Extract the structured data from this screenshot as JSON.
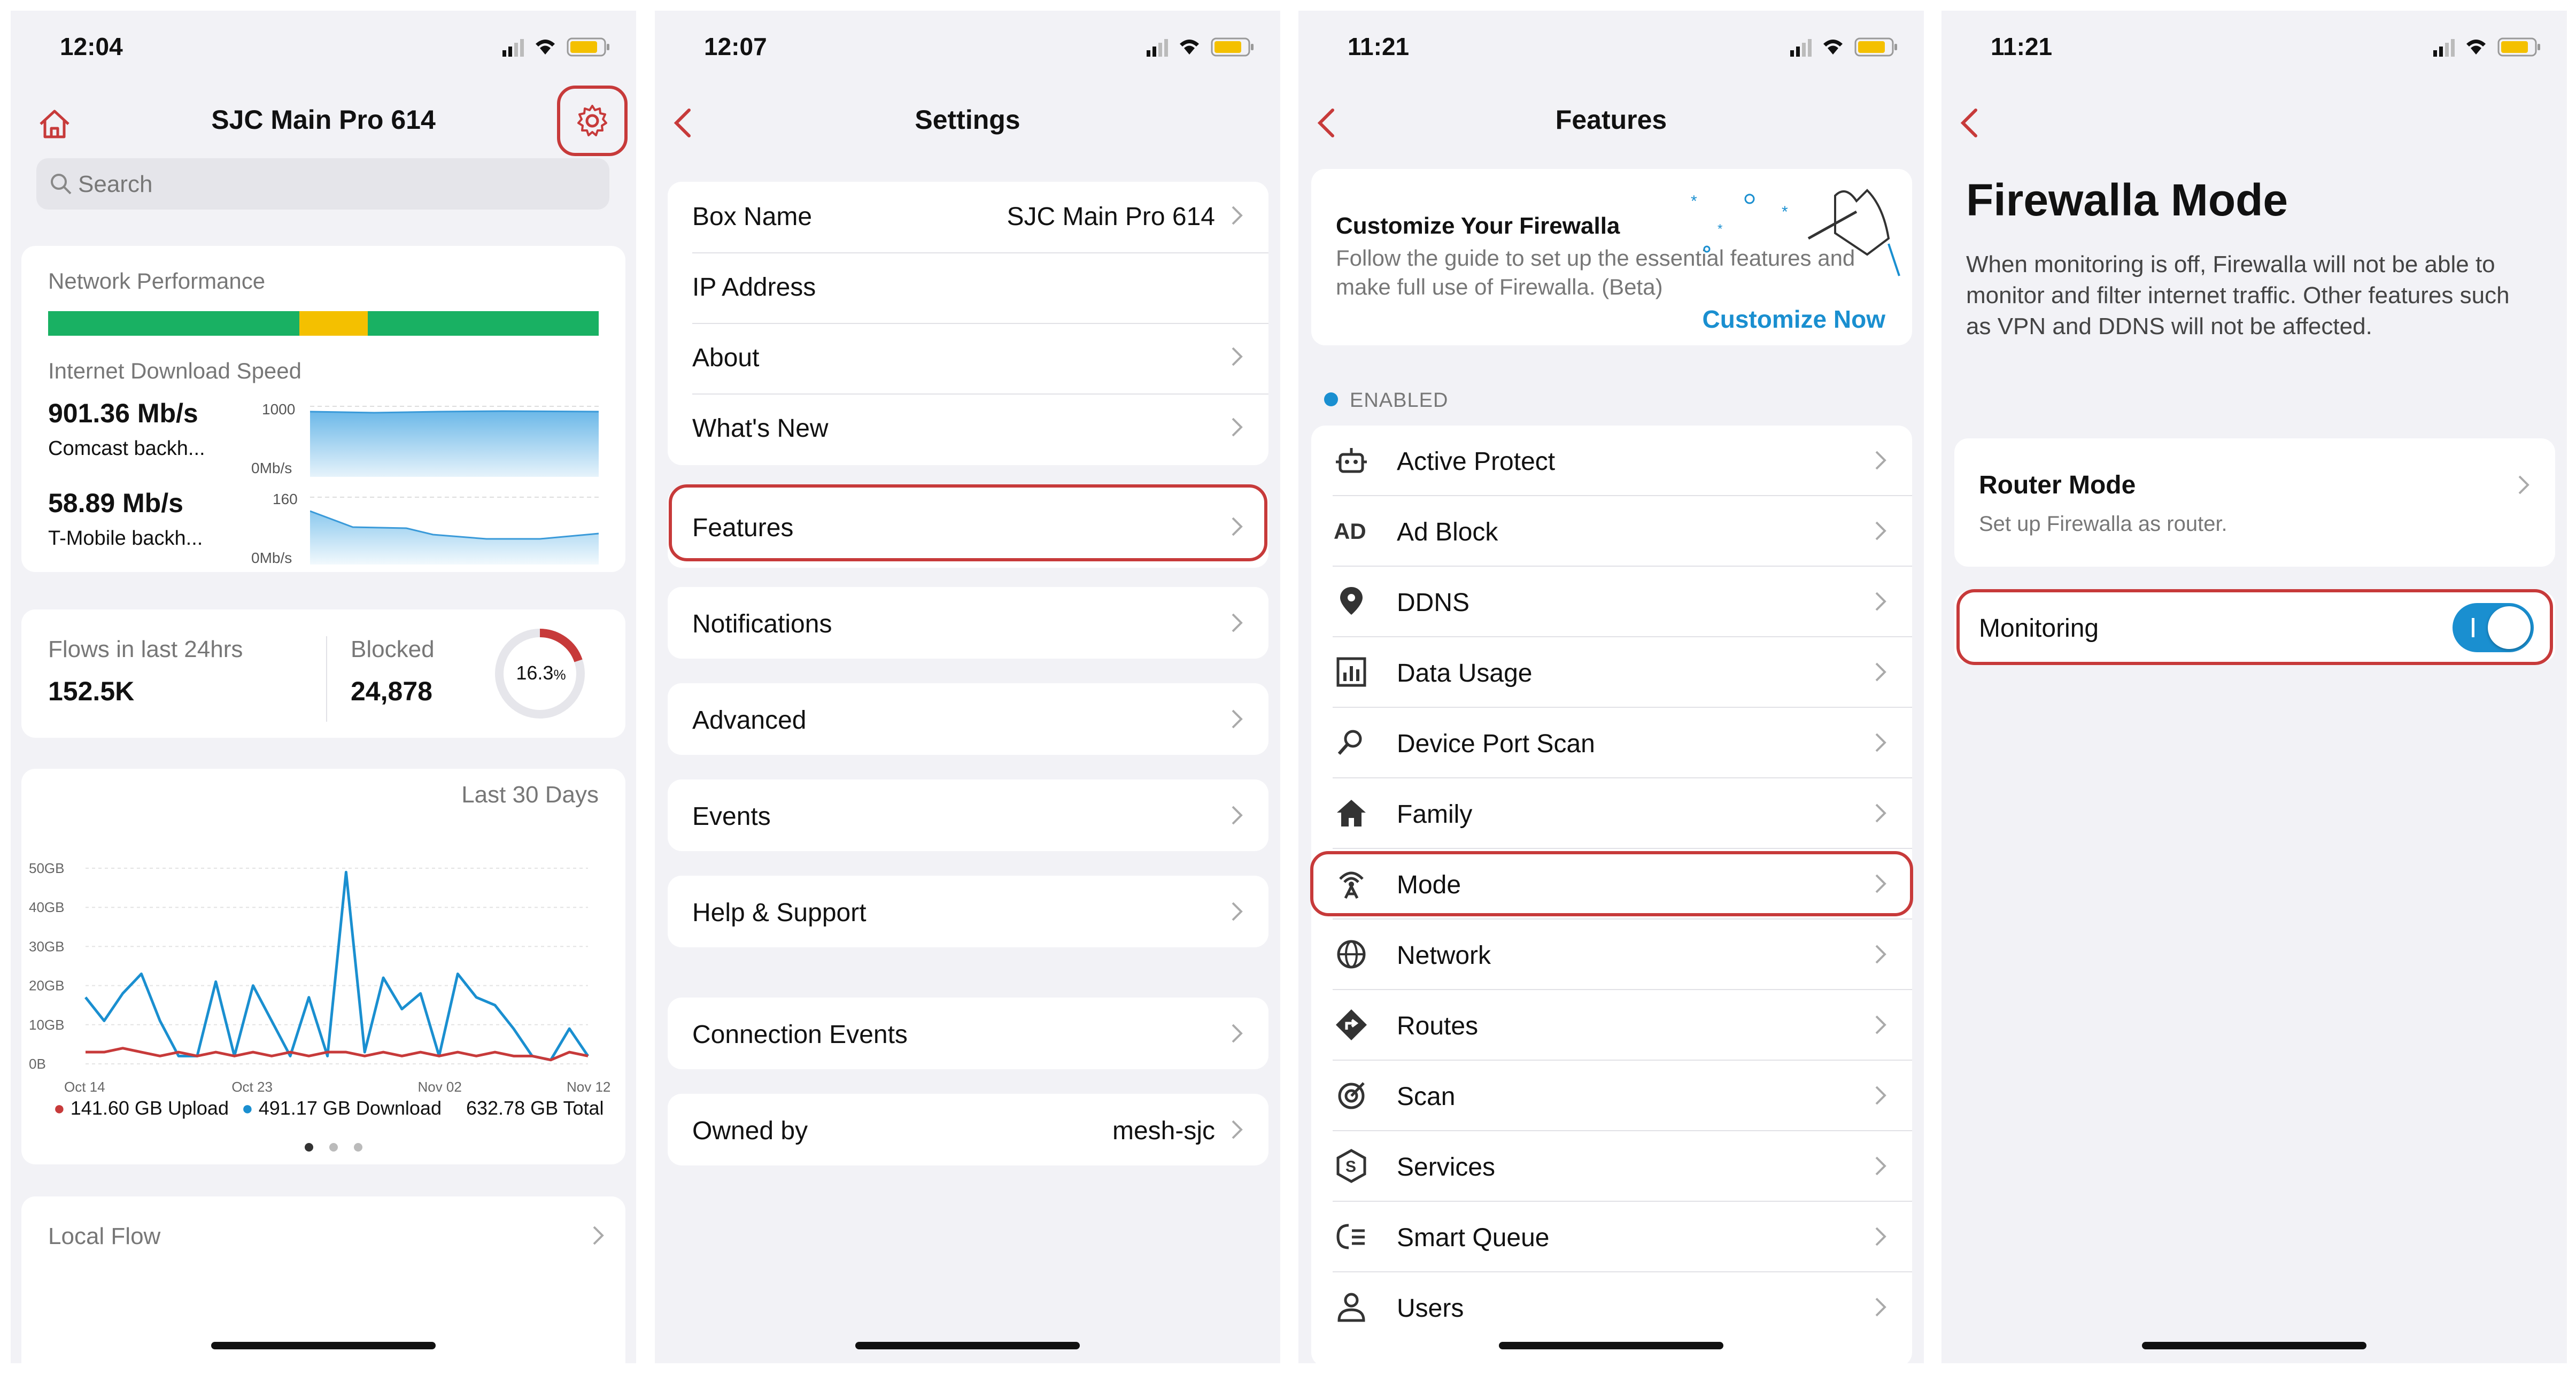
{
  "colors": {
    "accent": "#c73a3a",
    "link": "#1a8fd0",
    "green": "#19b163",
    "yellow": "#f4c000",
    "toggle": "#1a8fd0"
  },
  "screen1": {
    "time": "12:04",
    "title": "SJC Main Pro 614",
    "search_placeholder": "Search",
    "network_performance_label": "Network Performance",
    "internet_download_label": "Internet Download Speed",
    "wan1": {
      "speed": "901.36 Mb/s",
      "name": "Comcast backh...",
      "axis_top": "1000",
      "axis_bottom": "0Mb/s"
    },
    "wan2": {
      "speed": "58.89 Mb/s",
      "name": "T-Mobile backh...",
      "axis_top": "160",
      "axis_bottom": "0Mb/s"
    },
    "flows_label": "Flows in last 24hrs",
    "flows_value": "152.5K",
    "blocked_label": "Blocked",
    "blocked_value": "24,878",
    "blocked_percent": "16.3",
    "blocked_percent_unit": "%",
    "period_label": "Last 30 Days",
    "y_ticks": [
      "50GB",
      "40GB",
      "30GB",
      "20GB",
      "10GB",
      "0B"
    ],
    "x_ticks": [
      "Oct 14",
      "Oct 23",
      "Nov 02",
      "Nov 12"
    ],
    "legend_upload": "141.60 GB Upload",
    "legend_download": "491.17 GB Download",
    "legend_total": "632.78 GB Total",
    "local_flow_label": "Local Flow"
  },
  "chart_data": {
    "type": "line",
    "ylabel": "",
    "ylim": [
      0,
      50
    ],
    "x_ticks": [
      "Oct 14",
      "Oct 23",
      "Nov 02",
      "Nov 12"
    ],
    "series": [
      {
        "name": "Download",
        "values": [
          17,
          11,
          18,
          23,
          11,
          2,
          2,
          21,
          2,
          20,
          11,
          2,
          17,
          2,
          49,
          3,
          22,
          14,
          18,
          2,
          23,
          17,
          15,
          9,
          2,
          1,
          9,
          2
        ]
      },
      {
        "name": "Upload",
        "values": [
          3,
          3,
          4,
          3,
          2,
          3,
          2,
          3,
          2,
          3,
          2,
          3,
          2,
          3,
          3,
          2,
          3,
          2,
          3,
          2,
          3,
          2,
          3,
          2,
          2,
          1,
          3,
          2
        ]
      }
    ]
  },
  "screen2": {
    "time": "12:07",
    "title": "Settings",
    "box_name_label": "Box Name",
    "box_name_value": "SJC Main Pro 614",
    "ip_label": "IP Address",
    "about_label": "About",
    "whats_new_label": "What's New",
    "features_label": "Features",
    "notifications_label": "Notifications",
    "advanced_label": "Advanced",
    "events_label": "Events",
    "help_label": "Help & Support",
    "connection_events_label": "Connection Events",
    "owned_by_label": "Owned by",
    "owned_by_value": "mesh-sjc"
  },
  "screen3": {
    "time": "11:21",
    "title": "Features",
    "customize_title": "Customize Your Firewalla",
    "customize_desc": "Follow the guide to set up the essential features and make full use of Firewalla. (Beta)",
    "customize_link": "Customize Now",
    "enabled_label": "ENABLED",
    "features": [
      {
        "label": "Active Protect",
        "icon": "robot-icon"
      },
      {
        "label": "Ad Block",
        "icon": "ad-icon"
      },
      {
        "label": "DDNS",
        "icon": "location-pin-icon"
      },
      {
        "label": "Data Usage",
        "icon": "bar-chart-icon"
      },
      {
        "label": "Device Port Scan",
        "icon": "magnifier-icon"
      },
      {
        "label": "Family",
        "icon": "house-icon"
      },
      {
        "label": "Mode",
        "icon": "antenna-icon"
      },
      {
        "label": "Network",
        "icon": "globe-icon"
      },
      {
        "label": "Routes",
        "icon": "route-sign-icon"
      },
      {
        "label": "Scan",
        "icon": "target-icon"
      },
      {
        "label": "Services",
        "icon": "services-icon"
      },
      {
        "label": "Smart Queue",
        "icon": "queue-icon"
      },
      {
        "label": "Users",
        "icon": "user-icon"
      }
    ]
  },
  "screen4": {
    "time": "11:21",
    "title": "Firewalla Mode",
    "description": "When monitoring is off, Firewalla will not be able to monitor and filter internet traffic. Other features such as VPN and DDNS will not be affected.",
    "router_mode_label": "Router Mode",
    "router_mode_desc": "Set up Firewalla as router.",
    "monitoring_label": "Monitoring",
    "monitoring_on": true
  }
}
